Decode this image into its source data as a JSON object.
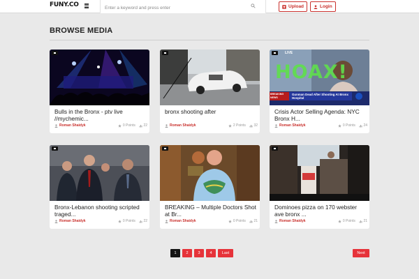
{
  "header": {
    "logo": "FUNY.CO",
    "search_placeholder": "Enter a keyword and press enter",
    "upload_label": "Upload",
    "login_label": "Login"
  },
  "page": {
    "title": "BROWSE MEDIA"
  },
  "media": [
    {
      "title": "Bulls in the Bronx - ptv live //mychemic...",
      "author": "Roman Shaidyk",
      "points": "0 Points",
      "views": "22",
      "live": false
    },
    {
      "title": "bronx shooting after",
      "author": "Roman Shaidyk",
      "points": "2 Points",
      "views": "32",
      "live": false
    },
    {
      "title": "Crisis Actor Selling Agenda: NYC Bronx H...",
      "author": "Roman Shaidyk",
      "points": "0 Points",
      "views": "24",
      "live": true,
      "overlay": {
        "live": "LIVE",
        "hoax": "HOAX!",
        "news_tag": "BREAKING NEWS",
        "ticker": "Gunman Dead After Shooting At Bronx Hospital"
      }
    },
    {
      "title": "Bronx-Lebanon shooting scripted traged...",
      "author": "Roman Shaidyk",
      "points": "0 Points",
      "views": "22",
      "live": false
    },
    {
      "title": "BREAKING – Multiple Doctors Shot at Br...",
      "author": "Roman Shaidyk",
      "points": "0 Points",
      "views": "21",
      "live": false
    },
    {
      "title": "Dominoes pizza on 170 webster ave bronx ...",
      "author": "Roman Shaidyk",
      "points": "0 Points",
      "views": "21",
      "live": false
    }
  ],
  "pagination": {
    "pages": [
      "1",
      "2",
      "3",
      "4"
    ],
    "last_label": "Last",
    "next_label": "Next",
    "current": "1"
  },
  "colors": {
    "accent": "#e6333a",
    "background": "#e9e9e9",
    "card": "#ffffff"
  }
}
